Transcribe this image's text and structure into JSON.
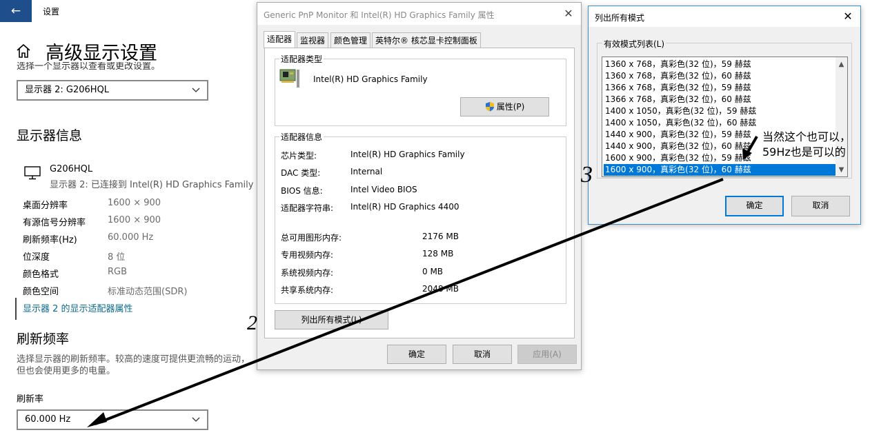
{
  "settings": {
    "back_icon": "back-arrow-icon",
    "title": "设置",
    "page_title": "高级显示设置",
    "clipped_text": "选择一个显示器以查看或更改设置。",
    "display_select": "显示器 2: G206HQL",
    "section_info": "显示器信息",
    "monitor_name": "G206HQL",
    "monitor_sub": "显示器 2: 已连接到 Intel(R) HD Graphics Family",
    "info": [
      {
        "label": "桌面分辨率",
        "value": "1600 × 900"
      },
      {
        "label": "有源信号分辨率",
        "value": "1600 × 900"
      },
      {
        "label": "刷新频率(Hz)",
        "value": "60.000 Hz"
      },
      {
        "label": "位深度",
        "value": "8 位"
      },
      {
        "label": "颜色格式",
        "value": "RGB"
      },
      {
        "label": "颜色空间",
        "value": "标准动态范围(SDR)"
      }
    ],
    "adapter_link": "显示器 2 的显示适配器属性",
    "section_refresh": "刷新频率",
    "refresh_desc": "选择显示器的刷新频率。较高的速度可提供更流畅的运动，但也会使用更多的电量。",
    "rate_label": "刷新率",
    "rate_value": "60.000 Hz"
  },
  "props": {
    "title": "Generic PnP Monitor 和 Intel(R) HD Graphics Family 属性",
    "tabs": [
      "适配器",
      "监视器",
      "颜色管理",
      "英特尔® 核芯显卡控制面板"
    ],
    "adapter_type_label": "适配器类型",
    "adapter_name": "Intel(R) HD Graphics Family",
    "properties_button": "属性(P)",
    "adapter_info_label": "适配器信息",
    "info": [
      {
        "label": "芯片类型:",
        "value": "Intel(R) HD Graphics Family"
      },
      {
        "label": "DAC 类型:",
        "value": "Internal"
      },
      {
        "label": "BIOS 信息:",
        "value": "Intel Video BIOS"
      },
      {
        "label": "适配器字符串:",
        "value": "Intel(R) HD Graphics 4400"
      }
    ],
    "memory": [
      {
        "label": "总可用图形内存:",
        "value": "2176 MB"
      },
      {
        "label": "专用视频内存:",
        "value": "128 MB"
      },
      {
        "label": "系统视频内存:",
        "value": "0 MB"
      },
      {
        "label": "共享系统内存:",
        "value": "2048 MB"
      }
    ],
    "list_modes_button": "列出所有模式(L)",
    "ok": "确定",
    "cancel": "取消",
    "apply": "应用(A)"
  },
  "modes": {
    "title": "列出所有模式",
    "group_label": "有效模式列表(L)",
    "items": [
      "1360 x 768，真彩色(32 位)，59 赫兹",
      "1360 x 768，真彩色(32 位)，60 赫兹",
      "1366 x 768，真彩色(32 位)，59 赫兹",
      "1366 x 768，真彩色(32 位)，60 赫兹",
      "1400 x 1050，真彩色(32 位)，59 赫兹",
      "1400 x 1050，真彩色(32 位)，60 赫兹",
      "1440 x 900，真彩色(32 位)，59 赫兹",
      "1440 x 900，真彩色(32 位)，60 赫兹",
      "1600 x 900，真彩色(32 位)，59 赫兹",
      "1600 x 900，真彩色(32 位)，60 赫兹"
    ],
    "selected_index": 9,
    "ok": "确定",
    "cancel": "取消"
  },
  "annotation": {
    "note_line1": "当然这个也可以，",
    "note_line2": "59Hz也是可以的",
    "step2": "2",
    "step3": "3"
  },
  "colors": {
    "accent": "#0078d7",
    "link": "#0b6a8e",
    "back_button": "#1f4e8c"
  }
}
